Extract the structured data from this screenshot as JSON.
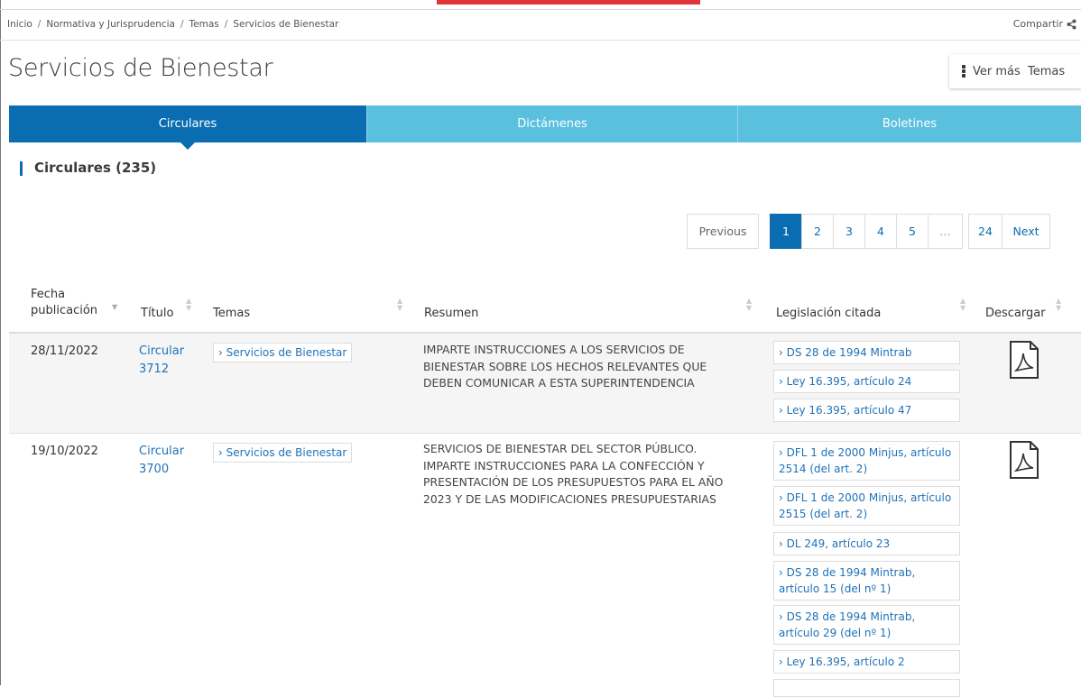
{
  "breadcrumb": {
    "items": [
      "Inicio",
      "Normativa y Jurisprudencia",
      "Temas",
      "Servicios de Bienestar"
    ],
    "separator": "/"
  },
  "share": {
    "label": "Compartir"
  },
  "page": {
    "title": "Servicios de Bienestar"
  },
  "vermas": {
    "label": "Ver más  Temas"
  },
  "tabs": [
    {
      "label": "Circulares",
      "active": true
    },
    {
      "label": "Dictámenes",
      "active": false
    },
    {
      "label": "Boletines",
      "active": false
    }
  ],
  "section": {
    "title": "Circulares (235)"
  },
  "pagination": {
    "previous": "Previous",
    "pages": [
      "1",
      "2",
      "3",
      "4",
      "5"
    ],
    "ellipsis": "…",
    "last": "24",
    "next": "Next",
    "current": "1"
  },
  "table": {
    "headers": {
      "fecha_line1": "Fecha",
      "fecha_line2": "publicación",
      "titulo": "Título",
      "temas": "Temas",
      "resumen": "Resumen",
      "legislacion": "Legislación citada",
      "descargar": "Descargar"
    },
    "rows": [
      {
        "fecha": "28/11/2022",
        "titulo_line1": "Circular",
        "titulo_line2": "3712",
        "tema": "› Servicios de Bienestar",
        "resumen": [
          "IMPARTE INSTRUCCIONES A LOS SERVICIOS DE",
          "BIENESTAR SOBRE LOS HECHOS RELEVANTES QUE",
          "DEBEN COMUNICAR A ESTA SUPERINTENDENCIA"
        ],
        "legislacion": [
          "› DS 28 de 1994 Mintrab",
          "› Ley 16.395, artículo 24",
          "› Ley 16.395, artículo 47"
        ]
      },
      {
        "fecha": "19/10/2022",
        "titulo_line1": "Circular",
        "titulo_line2": "3700",
        "tema": "› Servicios de Bienestar",
        "resumen": [
          "SERVICIOS DE BIENESTAR DEL SECTOR PÚBLICO.",
          "IMPARTE INSTRUCCIONES PARA LA CONFECCIÓN Y",
          "PRESENTACIÓN DE LOS PRESUPUESTOS PARA EL AÑO",
          "2023 Y DE LAS MODIFICACIONES PRESUPUESTARIAS"
        ],
        "legislacion": [
          {
            "l1": "› DFL 1 de 2000 Minjus, artículo",
            "l2": "2514 (del art. 2)"
          },
          {
            "l1": "› DFL 1 de 2000 Minjus, artículo",
            "l2": "2515 (del art. 2)"
          },
          {
            "l1": "› DL 249, artículo 23",
            "l2": ""
          },
          {
            "l1": "› DS 28 de 1994 Mintrab,",
            "l2": "artículo 15 (del nº 1)"
          },
          {
            "l1": "› DS 28 de 1994 Mintrab,",
            "l2": "artículo 29 (del nº 1)"
          },
          {
            "l1": "› Ley 16.395, artículo 2",
            "l2": ""
          }
        ]
      }
    ]
  },
  "colors": {
    "primary": "#0a6db1",
    "tab_inactive": "#5bc0de",
    "accent_red": "#e0363a"
  },
  "icons": {
    "download": "pdf-icon",
    "share": "share-icon",
    "more": "kebab-icon"
  }
}
